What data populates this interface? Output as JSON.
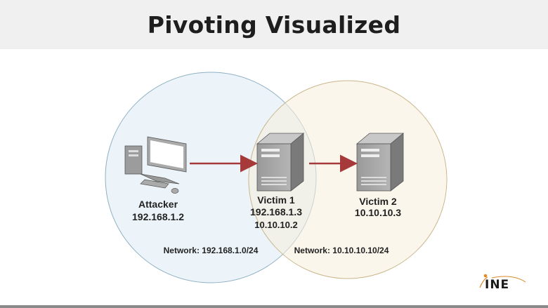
{
  "title": "Pivoting Visualized",
  "nodes": {
    "attacker": {
      "name": "Attacker",
      "ip": "192.168.1.2",
      "icon": "desktop-computer-icon"
    },
    "victim1": {
      "name": "Victim 1",
      "ip1": "192.168.1.3",
      "ip2": "10.10.10.2",
      "icon": "server-icon"
    },
    "victim2": {
      "name": "Victim 2",
      "ip": "10.10.10.3",
      "icon": "server-icon"
    }
  },
  "networks": [
    {
      "label": "Network: 192.168.1.0/24",
      "color": "#eaf3f8"
    },
    {
      "label": "Network: 10.10.10.10/24",
      "color": "#fbf5ea"
    }
  ],
  "arrow_color": "#a63a3a",
  "logo": "INE"
}
